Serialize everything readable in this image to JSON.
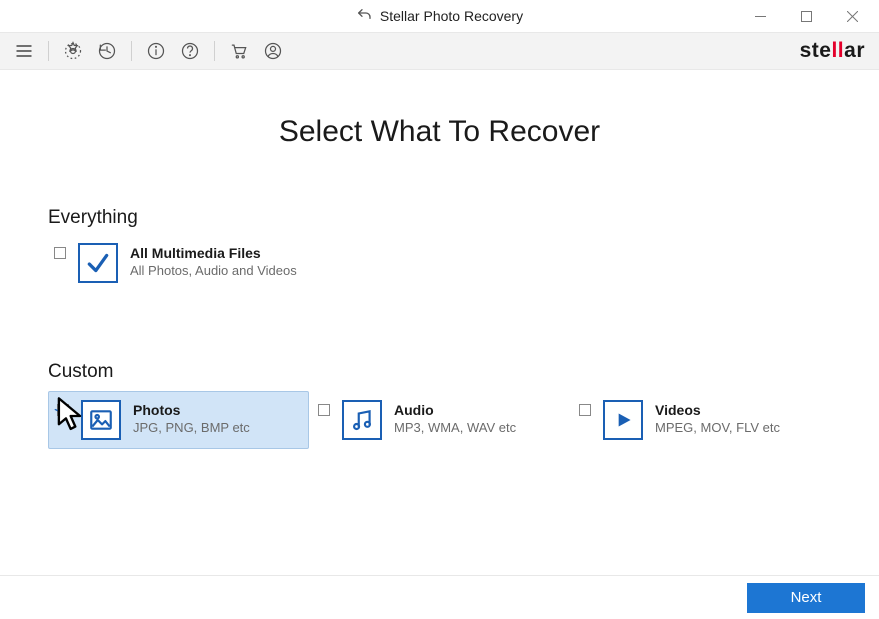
{
  "window": {
    "title": "Stellar Photo Recovery"
  },
  "logo": "stellar",
  "page": {
    "title": "Select What To Recover"
  },
  "sections": {
    "everything": {
      "heading": "Everything",
      "option": {
        "label": "All Multimedia Files",
        "sub": "All Photos, Audio and Videos",
        "checked": false
      }
    },
    "custom": {
      "heading": "Custom",
      "options": [
        {
          "label": "Photos",
          "sub": "JPG, PNG, BMP etc",
          "checked": true
        },
        {
          "label": "Audio",
          "sub": "MP3, WMA, WAV etc",
          "checked": false
        },
        {
          "label": "Videos",
          "sub": "MPEG, MOV, FLV etc",
          "checked": false
        }
      ]
    }
  },
  "footer": {
    "next": "Next"
  },
  "icons": {
    "back": "back-arrow-icon",
    "hamburger": "hamburger-icon",
    "gear": "gear-icon",
    "history": "history-icon",
    "info": "info-icon",
    "help": "help-icon",
    "cart": "cart-icon",
    "user": "user-icon",
    "minimize": "minimize-icon",
    "maximize": "maximize-icon",
    "close": "close-icon"
  },
  "colors": {
    "accent": "#1a5fb4",
    "button": "#1d76d3",
    "highlight": "#d1e4f7",
    "brand_red": "#e4002b"
  }
}
